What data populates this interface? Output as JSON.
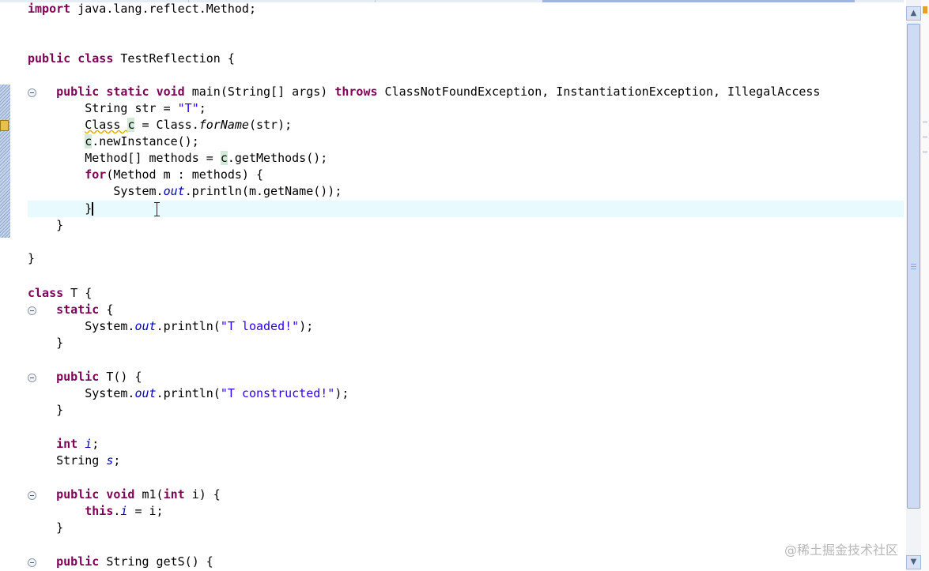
{
  "editor": {
    "lines": {
      "import_kw": "import",
      "import_rest": " java.lang.reflect.Method;",
      "l3_kw1": "public",
      "l3_kw2": "class",
      "l3_rest": " TestReflection {",
      "l5_kw1": "public",
      "l5_kw2": "static",
      "l5_kw3": "void",
      "l5_mid": " main(String[] args) ",
      "l5_kw4": "throws",
      "l5_rest": " ClassNotFoundException, InstantiationException, IllegalAccess",
      "l6_a": "String str = ",
      "l6_str": "\"T\"",
      "l6_b": ";",
      "l7_a": "Class ",
      "l7_var": "c",
      "l7_b": " = Class.",
      "l7_m": "forName",
      "l7_c": "(str);",
      "l8_var": "c",
      "l8_rest": ".newInstance();",
      "l9_a": "Method[] methods = ",
      "l9_var": "c",
      "l9_b": ".getMethods();",
      "l10_kw": "for",
      "l10_rest": "(Method m : methods) {",
      "l11_a": "System.",
      "l11_fld": "out",
      "l11_b": ".println(m.getName());",
      "l12": "}",
      "l13": "}",
      "l15": "}",
      "l17_kw": "class",
      "l17_rest": " T {",
      "l18_kw": "static",
      "l18_rest": " {",
      "l19_a": "System.",
      "l19_fld": "out",
      "l19_b": ".println(",
      "l19_str": "\"T loaded!\"",
      "l19_c": ");",
      "l20": "}",
      "l22_kw": "public",
      "l22_rest": " T() {",
      "l23_a": "System.",
      "l23_fld": "out",
      "l23_b": ".println(",
      "l23_str": "\"T constructed!\"",
      "l23_c": ");",
      "l24": "}",
      "l26_kw": "int",
      "l26_sp": " ",
      "l26_fld": "i",
      "l26_rest": ";",
      "l27_a": "String ",
      "l27_fld": "s",
      "l27_rest": ";",
      "l29_kw1": "public",
      "l29_kw2": "void",
      "l29_mid": " m1(",
      "l29_kw3": "int",
      "l29_rest": " i) {",
      "l30_kw": "this",
      "l30_dot": ".",
      "l30_fld": "i",
      "l30_rest": " = i;",
      "l31": "}",
      "l33_kw": "public",
      "l33_rest": " String getS() {"
    }
  },
  "scrollbar": {
    "up_arrow": "▲",
    "down_arrow": "▼"
  },
  "watermark": "@稀土掘金技术社区",
  "colors": {
    "keyword": "#7f0055",
    "string": "#2a00ff",
    "field": "#0000c0",
    "current_line": "#e8fafd"
  }
}
